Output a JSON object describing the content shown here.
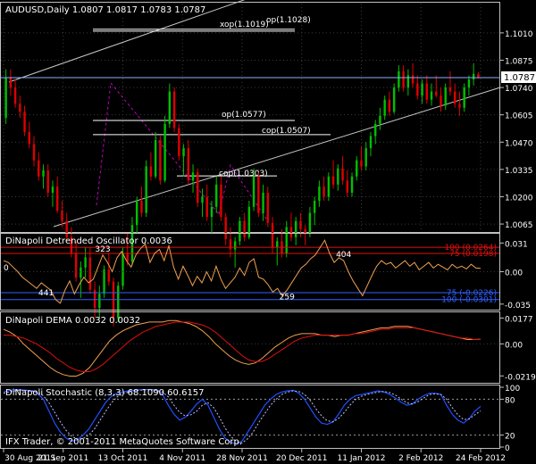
{
  "colors": {
    "background": "#000000",
    "grid": "#3a3a3a",
    "frame": "#c0c0c0",
    "text": "#ffffff",
    "bull": "#00c000",
    "bear": "#e00000",
    "orange": "#f0a050",
    "red_line": "#e01010",
    "blue": "#2050ff",
    "level_blue": "#3060ff",
    "magenta": "#c000c0",
    "current_price_bg": "#ffffff",
    "current_price_text": "#000000"
  },
  "chart_data": [
    {
      "type": "candlestick",
      "title": "AUDUSD,Daily  1.0807 1.0817 1.0783 1.0787",
      "y_ticks": [
        "1.1010",
        "1.0875",
        "1.0740",
        "1.0605",
        "1.0470",
        "1.0335",
        "1.0200",
        "1.0065"
      ],
      "y_values": [
        1.101,
        1.0875,
        1.074,
        1.0605,
        1.047,
        1.0335,
        1.02,
        1.0065
      ],
      "ylim": [
        1.003,
        1.1155
      ],
      "current_price_label": "1.0787",
      "current_price": 1.0787,
      "horizontal_levels": [
        {
          "label": "xop(1.1019)",
          "value": 1.1019
        },
        {
          "label": "op(1.1028)",
          "value": 1.1028
        },
        {
          "label": "op(1.0577)",
          "value": 1.0577
        },
        {
          "label": "cop(1.0507)",
          "value": 1.0507
        },
        {
          "label": "cop(1.0303)",
          "value": 1.0303
        }
      ],
      "candles": [
        [
          1.059,
          1.083,
          1.056,
          1.079
        ],
        [
          1.079,
          1.083,
          1.07,
          1.074
        ],
        [
          1.074,
          1.078,
          1.064,
          1.066
        ],
        [
          1.066,
          1.07,
          1.059,
          1.062
        ],
        [
          1.062,
          1.065,
          1.05,
          1.052
        ],
        [
          1.052,
          1.057,
          1.044,
          1.046
        ],
        [
          1.046,
          1.05,
          1.035,
          1.038
        ],
        [
          1.038,
          1.042,
          1.028,
          1.03
        ],
        [
          1.03,
          1.036,
          1.024,
          1.033
        ],
        [
          1.033,
          1.036,
          1.02,
          1.022
        ],
        [
          1.022,
          1.028,
          1.015,
          1.025
        ],
        [
          1.025,
          1.03,
          1.012,
          1.013
        ],
        [
          1.013,
          1.018,
          1.005,
          1.008
        ],
        [
          1.008,
          1.012,
          0.998,
          1.0
        ],
        [
          1.0,
          1.005,
          0.99,
          0.992
        ],
        [
          0.992,
          0.998,
          0.978,
          0.98
        ],
        [
          0.98,
          0.988,
          0.97,
          0.985
        ],
        [
          0.985,
          0.995,
          0.98,
          0.99
        ],
        [
          0.99,
          0.995,
          0.972,
          0.974
        ],
        [
          0.974,
          0.978,
          0.96,
          0.965
        ],
        [
          0.965,
          0.976,
          0.96,
          0.972
        ],
        [
          0.972,
          0.986,
          0.97,
          0.984
        ],
        [
          0.984,
          0.992,
          0.976,
          0.978
        ],
        [
          0.978,
          0.98,
          0.956,
          0.96
        ],
        [
          0.96,
          0.978,
          0.958,
          0.976
        ],
        [
          0.976,
          0.995,
          0.974,
          0.992
        ],
        [
          0.992,
          1.002,
          0.986,
          0.988
        ],
        [
          0.988,
          1.01,
          0.986,
          1.006
        ],
        [
          1.006,
          1.02,
          1.002,
          1.018
        ],
        [
          1.018,
          1.025,
          1.01,
          1.012
        ],
        [
          1.012,
          1.038,
          1.01,
          1.035
        ],
        [
          1.035,
          1.042,
          1.028,
          1.03
        ],
        [
          1.03,
          1.052,
          1.029,
          1.048
        ],
        [
          1.048,
          1.05,
          1.026,
          1.028
        ],
        [
          1.028,
          1.06,
          1.027,
          1.056
        ],
        [
          1.056,
          1.076,
          1.054,
          1.072
        ],
        [
          1.072,
          1.074,
          1.052,
          1.054
        ],
        [
          1.054,
          1.056,
          1.038,
          1.04
        ],
        [
          1.04,
          1.046,
          1.03,
          1.044
        ],
        [
          1.044,
          1.048,
          1.026,
          1.028
        ],
        [
          1.028,
          1.036,
          1.022,
          1.032
        ],
        [
          1.032,
          1.034,
          1.015,
          1.017
        ],
        [
          1.017,
          1.024,
          1.01,
          1.02
        ],
        [
          1.02,
          1.026,
          1.008,
          1.01
        ],
        [
          1.01,
          1.018,
          1.002,
          1.015
        ],
        [
          1.015,
          1.03,
          1.012,
          1.026
        ],
        [
          1.026,
          1.03,
          1.008,
          1.01
        ],
        [
          1.01,
          1.012,
          0.996,
          0.999
        ],
        [
          0.999,
          1.005,
          0.99,
          0.994
        ],
        [
          0.994,
          1.0,
          0.985,
          0.998
        ],
        [
          0.998,
          1.01,
          0.996,
          1.008
        ],
        [
          1.008,
          1.012,
          0.998,
          1.0
        ],
        [
          1.0,
          1.018,
          0.999,
          1.015
        ],
        [
          1.015,
          1.034,
          1.013,
          1.03
        ],
        [
          1.03,
          1.032,
          1.01,
          1.012
        ],
        [
          1.012,
          1.026,
          1.008,
          1.022
        ],
        [
          1.022,
          1.025,
          1.005,
          1.007
        ],
        [
          1.007,
          1.01,
          0.992,
          0.995
        ],
        [
          0.995,
          1.0,
          0.986,
          0.998
        ],
        [
          0.998,
          1.004,
          0.99,
          0.992
        ],
        [
          0.992,
          1.008,
          0.99,
          1.005
        ],
        [
          1.005,
          1.012,
          0.998,
          1.0
        ],
        [
          1.0,
          1.01,
          0.996,
          1.008
        ],
        [
          1.008,
          1.012,
          1.0,
          1.004
        ],
        [
          1.004,
          1.006,
          0.996,
          1.002
        ],
        [
          1.002,
          1.015,
          1.0,
          1.012
        ],
        [
          1.012,
          1.02,
          1.006,
          1.018
        ],
        [
          1.018,
          1.028,
          1.015,
          1.025
        ],
        [
          1.025,
          1.03,
          1.018,
          1.02
        ],
        [
          1.02,
          1.032,
          1.018,
          1.03
        ],
        [
          1.03,
          1.038,
          1.024,
          1.026
        ],
        [
          1.026,
          1.036,
          1.023,
          1.034
        ],
        [
          1.034,
          1.04,
          1.026,
          1.028
        ],
        [
          1.028,
          1.033,
          1.02,
          1.022
        ],
        [
          1.022,
          1.032,
          1.02,
          1.03
        ],
        [
          1.03,
          1.04,
          1.028,
          1.038
        ],
        [
          1.038,
          1.045,
          1.033,
          1.035
        ],
        [
          1.035,
          1.047,
          1.033,
          1.044
        ],
        [
          1.044,
          1.052,
          1.04,
          1.05
        ],
        [
          1.05,
          1.058,
          1.046,
          1.056
        ],
        [
          1.056,
          1.064,
          1.053,
          1.06
        ],
        [
          1.06,
          1.07,
          1.058,
          1.068
        ],
        [
          1.068,
          1.072,
          1.06,
          1.062
        ],
        [
          1.062,
          1.076,
          1.061,
          1.074
        ],
        [
          1.074,
          1.085,
          1.072,
          1.082
        ],
        [
          1.082,
          1.085,
          1.072,
          1.074
        ],
        [
          1.074,
          1.083,
          1.07,
          1.08
        ],
        [
          1.08,
          1.086,
          1.074,
          1.076
        ],
        [
          1.076,
          1.08,
          1.068,
          1.07
        ],
        [
          1.07,
          1.078,
          1.066,
          1.076
        ],
        [
          1.076,
          1.08,
          1.066,
          1.068
        ],
        [
          1.068,
          1.076,
          1.065,
          1.072
        ],
        [
          1.072,
          1.08,
          1.069,
          1.07
        ],
        [
          1.07,
          1.074,
          1.062,
          1.065
        ],
        [
          1.065,
          1.076,
          1.063,
          1.074
        ],
        [
          1.074,
          1.082,
          1.07,
          1.072
        ],
        [
          1.072,
          1.076,
          1.064,
          1.066
        ],
        [
          1.066,
          1.072,
          1.06,
          1.064
        ],
        [
          1.064,
          1.076,
          1.062,
          1.074
        ],
        [
          1.074,
          1.08,
          1.07,
          1.078
        ],
        [
          1.078,
          1.086,
          1.075,
          1.0807
        ],
        [
          1.0807,
          1.0817,
          1.0783,
          1.0787
        ]
      ]
    },
    {
      "type": "line",
      "title": "DiNapoli Detrended Oscillator 0.0036",
      "y_ticks": [
        "0.031",
        "0.00",
        "-0.035"
      ],
      "ylim": [
        -0.04,
        0.04
      ],
      "zero_label": "0",
      "levels": [
        {
          "label": "100 (0.0264)",
          "value": 0.0264,
          "color": "red"
        },
        {
          "label": "75 (0.0198)",
          "value": 0.0198,
          "color": "red"
        },
        {
          "label": "75 (-0.0226)",
          "value": -0.0226,
          "color": "blue"
        },
        {
          "label": "100 (-0.0301)",
          "value": -0.0301,
          "color": "blue"
        }
      ],
      "annotations": [
        {
          "label": "441",
          "index": 9
        },
        {
          "label": "323",
          "index": 21
        },
        {
          "label": "259",
          "index": 60
        },
        {
          "label": "404",
          "index": 72
        }
      ],
      "values": [
        0.012,
        0.01,
        0.005,
        0.0,
        -0.006,
        -0.01,
        -0.014,
        -0.018,
        -0.012,
        -0.016,
        -0.02,
        -0.03,
        -0.034,
        -0.02,
        -0.01,
        -0.024,
        -0.014,
        -0.006,
        -0.012,
        -0.008,
        0.005,
        0.018,
        0.01,
        0.0,
        0.015,
        0.022,
        0.012,
        0.005,
        0.018,
        0.025,
        0.03,
        0.01,
        0.02,
        0.024,
        0.012,
        0.028,
        0.005,
        -0.008,
        0.006,
        -0.004,
        -0.015,
        -0.005,
        -0.012,
        0.0,
        -0.01,
        0.006,
        -0.008,
        -0.018,
        -0.012,
        -0.006,
        0.004,
        -0.004,
        0.01,
        0.014,
        -0.006,
        -0.008,
        -0.014,
        -0.022,
        -0.018,
        -0.026,
        -0.02,
        -0.012,
        -0.004,
        0.004,
        0.008,
        0.014,
        0.018,
        0.026,
        0.034,
        0.02,
        0.01,
        0.015,
        0.012,
        0.0,
        -0.01,
        -0.018,
        -0.026,
        -0.015,
        -0.004,
        0.006,
        0.012,
        0.008,
        0.01,
        0.004,
        0.008,
        0.012,
        0.006,
        0.01,
        0.002,
        0.006,
        0.01,
        0.004,
        0.008,
        0.005,
        0.002,
        0.008,
        0.004,
        0.006,
        0.003,
        0.008,
        0.004,
        0.0036
      ]
    },
    {
      "type": "line",
      "title": "DiNapoli DEMA 0.0032 0.0032",
      "y_ticks": [
        "0.0177",
        "0.00",
        "-0.0219"
      ],
      "ylim": [
        -0.026,
        0.021
      ],
      "series": [
        {
          "values": [
            0.01,
            0.008,
            0.005,
            0.0,
            -0.004,
            -0.008,
            -0.012,
            -0.016,
            -0.019,
            -0.021,
            -0.022,
            -0.022,
            -0.02,
            -0.016,
            -0.01,
            -0.004,
            0.002,
            0.006,
            0.009,
            0.011,
            0.013,
            0.014,
            0.015,
            0.015,
            0.015,
            0.016,
            0.016,
            0.015,
            0.014,
            0.012,
            0.009,
            0.005,
            0.0,
            -0.004,
            -0.008,
            -0.011,
            -0.013,
            -0.014,
            -0.013,
            -0.01,
            -0.006,
            -0.002,
            0.001,
            0.004,
            0.006,
            0.007,
            0.007,
            0.007,
            0.006,
            0.006,
            0.005,
            0.006,
            0.006,
            0.007,
            0.008,
            0.009,
            0.01,
            0.011,
            0.011,
            0.012,
            0.012,
            0.012,
            0.011,
            0.01,
            0.009,
            0.008,
            0.007,
            0.006,
            0.005,
            0.004,
            0.003,
            0.003,
            0.0032
          ]
        },
        {
          "values": [
            0.006,
            0.006,
            0.005,
            0.004,
            0.002,
            0.0,
            -0.003,
            -0.006,
            -0.01,
            -0.013,
            -0.016,
            -0.018,
            -0.019,
            -0.019,
            -0.017,
            -0.014,
            -0.01,
            -0.006,
            -0.002,
            0.002,
            0.005,
            0.008,
            0.01,
            0.012,
            0.013,
            0.014,
            0.015,
            0.015,
            0.015,
            0.014,
            0.013,
            0.011,
            0.008,
            0.004,
            0.0,
            -0.004,
            -0.008,
            -0.011,
            -0.012,
            -0.012,
            -0.01,
            -0.007,
            -0.004,
            -0.001,
            0.002,
            0.004,
            0.005,
            0.006,
            0.006,
            0.006,
            0.006,
            0.006,
            0.006,
            0.007,
            0.007,
            0.008,
            0.009,
            0.01,
            0.01,
            0.011,
            0.011,
            0.011,
            0.011,
            0.01,
            0.009,
            0.008,
            0.007,
            0.006,
            0.005,
            0.004,
            0.004,
            0.003,
            0.0032
          ]
        }
      ]
    },
    {
      "type": "line",
      "title": "DiNapoli Stochastic (8,3,3) 68.1090 60.6157",
      "y_ticks": [
        "100",
        "80",
        "20",
        "0"
      ],
      "ylim": [
        0,
        100
      ],
      "levels": [
        80,
        20
      ],
      "series": [
        {
          "values": [
            92,
            95,
            96,
            96,
            95,
            94,
            90,
            80,
            60,
            40,
            25,
            15,
            10,
            12,
            20,
            30,
            45,
            60,
            75,
            85,
            90,
            92,
            94,
            95,
            96,
            96,
            96,
            95,
            88,
            70,
            55,
            45,
            50,
            60,
            72,
            80,
            70,
            50,
            30,
            15,
            8,
            5,
            10,
            25,
            40,
            55,
            70,
            80,
            88,
            92,
            94,
            95,
            90,
            80,
            65,
            50,
            40,
            38,
            42,
            55,
            70,
            80,
            86,
            88,
            90,
            92,
            94,
            92,
            88,
            82,
            75,
            70,
            72,
            80,
            86,
            90,
            90,
            88,
            70,
            55,
            45,
            40,
            48,
            60,
            68.109
          ]
        },
        {
          "values": [
            90,
            92,
            94,
            95,
            95,
            94,
            92,
            86,
            74,
            58,
            42,
            28,
            18,
            13,
            14,
            20,
            30,
            45,
            60,
            74,
            84,
            89,
            92,
            94,
            95,
            96,
            96,
            95,
            92,
            84,
            70,
            58,
            52,
            54,
            60,
            70,
            74,
            66,
            50,
            32,
            18,
            9,
            7,
            14,
            26,
            42,
            56,
            70,
            80,
            88,
            92,
            94,
            93,
            88,
            78,
            64,
            52,
            44,
            42,
            48,
            58,
            70,
            80,
            85,
            88,
            90,
            92,
            93,
            91,
            87,
            80,
            74,
            72,
            76,
            82,
            88,
            89,
            88,
            80,
            66,
            54,
            46,
            47,
            54,
            60.6157
          ]
        }
      ]
    },
    {
      "type": "axis",
      "x_ticks": [
        "30 Aug 2011",
        "21 Sep 2011",
        "13 Oct 2011",
        "4 Nov 2011",
        "28 Nov 2011",
        "20 Dec 2011",
        "11 Jan 2012",
        "2 Feb 2012",
        "24 Feb 2012"
      ]
    }
  ],
  "footer": {
    "copyright": "IFX Trader, © 2001-2011 MetaQuotes Software Corp."
  }
}
